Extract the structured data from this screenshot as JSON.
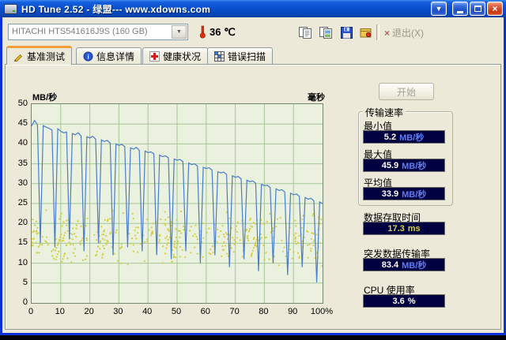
{
  "window": {
    "title": "HD Tune 2.52 - 绿盟--- www.xdowns.com",
    "icons": {
      "download": "▼",
      "close": "×"
    }
  },
  "toolbar": {
    "drive_selector": {
      "value": "HITACHI HTS541616J9S (160 GB)"
    },
    "temperature": "36 ℃",
    "exit": {
      "icon": "×",
      "label": "退出(X)"
    }
  },
  "tabs": [
    {
      "label": "基准测试",
      "active": true
    },
    {
      "label": "信息详情",
      "active": false
    },
    {
      "label": "健康状况",
      "active": false
    },
    {
      "label": "错误扫描",
      "active": false
    }
  ],
  "benchmark": {
    "start_button": "开始",
    "transfer_rate": {
      "group_title": "传输速率",
      "min": {
        "label": "最小值",
        "value": "5.2",
        "unit": "MB/秒"
      },
      "max": {
        "label": "最大值",
        "value": "45.9",
        "unit": "MB/秒"
      },
      "avg": {
        "label": "平均值",
        "value": "33.9",
        "unit": "MB/秒"
      }
    },
    "access_time": {
      "label": "数据存取时间",
      "value": "17.3",
      "unit": "ms"
    },
    "burst_rate": {
      "label": "突发数据传输率",
      "value": "83.4",
      "unit": "MB/秒"
    },
    "cpu_usage": {
      "label": "CPU 使用率",
      "value": "3.6",
      "unit": "%"
    }
  },
  "chart_data": {
    "type": "line",
    "left_axis_label": "MB/秒",
    "right_axis_label": "毫秒",
    "x_ticks": [
      "0",
      "10",
      "20",
      "30",
      "40",
      "50",
      "60",
      "70",
      "80",
      "90",
      "100%"
    ],
    "y_ticks": [
      50,
      45,
      40,
      35,
      30,
      25,
      20,
      15,
      10,
      5,
      0
    ],
    "xlim": [
      0,
      100
    ],
    "ylim": [
      0,
      50
    ],
    "grid": true,
    "transfer_rate_points": [
      [
        0,
        44.5
      ],
      [
        1,
        45.9
      ],
      [
        2,
        44.8
      ],
      [
        3,
        15.0
      ],
      [
        4,
        44.6
      ],
      [
        5,
        44.2
      ],
      [
        6,
        43.9
      ],
      [
        7,
        43.5
      ],
      [
        8,
        14.0
      ],
      [
        9,
        43.8
      ],
      [
        10,
        43.2
      ],
      [
        11,
        42.8
      ],
      [
        12,
        43.0
      ],
      [
        13,
        16.0
      ],
      [
        14,
        42.6
      ],
      [
        15,
        42.3
      ],
      [
        16,
        42.8
      ],
      [
        17,
        42.0
      ],
      [
        18,
        13.0
      ],
      [
        19,
        41.8
      ],
      [
        20,
        41.5
      ],
      [
        21,
        41.9
      ],
      [
        22,
        41.2
      ],
      [
        23,
        15.0
      ],
      [
        24,
        41.0
      ],
      [
        25,
        40.6
      ],
      [
        26,
        40.9
      ],
      [
        27,
        40.2
      ],
      [
        28,
        12.0
      ],
      [
        29,
        40.0
      ],
      [
        30,
        39.6
      ],
      [
        31,
        39.9
      ],
      [
        32,
        39.3
      ],
      [
        33,
        14.0
      ],
      [
        34,
        39.0
      ],
      [
        35,
        38.7
      ],
      [
        36,
        39.1
      ],
      [
        37,
        38.4
      ],
      [
        38,
        13.0
      ],
      [
        39,
        38.2
      ],
      [
        40,
        37.8
      ],
      [
        41,
        38.0
      ],
      [
        42,
        37.5
      ],
      [
        43,
        12.0
      ],
      [
        44,
        37.2
      ],
      [
        45,
        36.8
      ],
      [
        46,
        37.0
      ],
      [
        47,
        36.5
      ],
      [
        48,
        11.0
      ],
      [
        49,
        36.2
      ],
      [
        50,
        35.9
      ],
      [
        51,
        36.1
      ],
      [
        52,
        35.5
      ],
      [
        53,
        13.0
      ],
      [
        54,
        35.2
      ],
      [
        55,
        34.8
      ],
      [
        56,
        35.0
      ],
      [
        57,
        34.4
      ],
      [
        58,
        10.0
      ],
      [
        59,
        34.1
      ],
      [
        60,
        33.8
      ],
      [
        61,
        34.0
      ],
      [
        62,
        33.4
      ],
      [
        63,
        12.0
      ],
      [
        64,
        33.0
      ],
      [
        65,
        32.7
      ],
      [
        66,
        32.9
      ],
      [
        67,
        32.3
      ],
      [
        68,
        9.0
      ],
      [
        69,
        32.0
      ],
      [
        70,
        31.6
      ],
      [
        71,
        31.8
      ],
      [
        72,
        31.2
      ],
      [
        73,
        11.0
      ],
      [
        74,
        30.9
      ],
      [
        75,
        30.5
      ],
      [
        76,
        30.7
      ],
      [
        77,
        30.1
      ],
      [
        78,
        8.0
      ],
      [
        79,
        29.8
      ],
      [
        80,
        29.5
      ],
      [
        81,
        29.6
      ],
      [
        82,
        29.0
      ],
      [
        83,
        10.0
      ],
      [
        84,
        28.7
      ],
      [
        85,
        28.3
      ],
      [
        86,
        28.5
      ],
      [
        87,
        27.9
      ],
      [
        88,
        7.0
      ],
      [
        89,
        27.6
      ],
      [
        90,
        27.2
      ],
      [
        91,
        27.4
      ],
      [
        92,
        26.8
      ],
      [
        93,
        9.0
      ],
      [
        94,
        26.5
      ],
      [
        95,
        26.1
      ],
      [
        96,
        26.3
      ],
      [
        97,
        25.7
      ],
      [
        98,
        5.2
      ],
      [
        99,
        25.4
      ],
      [
        100,
        25.0
      ]
    ],
    "access_time_scatter": {
      "seed": 7,
      "count": 420,
      "y_min": 9,
      "y_max": 24
    },
    "colors": {
      "line": "#4A7CC8",
      "scatter": "#D4CE3C",
      "grid": "#A6C796",
      "plot_bg": "#EAF1DF"
    }
  }
}
